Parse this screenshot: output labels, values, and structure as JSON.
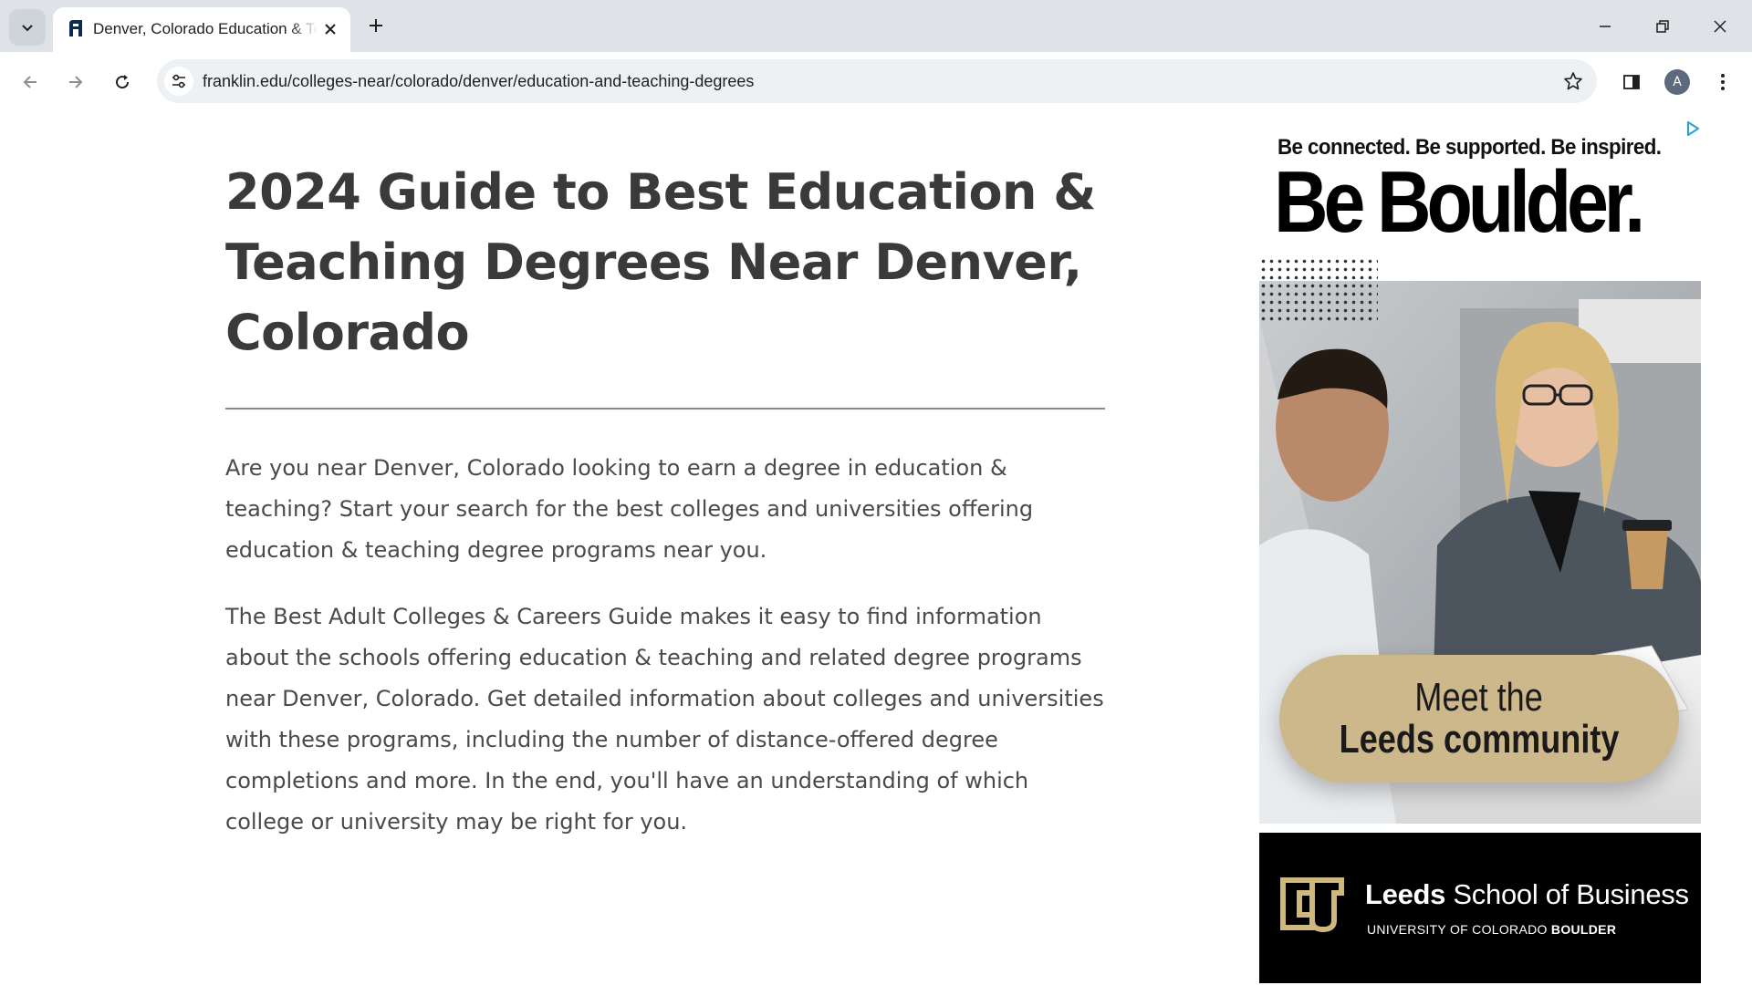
{
  "browser": {
    "tab": {
      "title": "Denver, Colorado Education & Teaching Degrees",
      "favicon": "franklin-logo-icon"
    },
    "url": "franklin.edu/colleges-near/colorado/denver/education-and-teaching-degrees",
    "profile_initial": "A",
    "colors": {
      "tabstrip": "#dfe3e7",
      "omnibox": "#eef1f4",
      "avatar": "#5d6a7d"
    }
  },
  "article": {
    "heading": "2024 Guide to Best Education & Teaching Degrees Near Denver, Colorado",
    "paragraph_1": "Are you near Denver, Colorado looking to earn a degree in education & teaching? Start your search for the best colleges and universities offering education & teaching degree programs near you.",
    "paragraph_2": "The Best Adult Colleges & Careers Guide makes it easy to find information about the schools offering education & teaching and related degree programs near Denver, Colorado. Get detailed information about colleges and universities with these programs, including the number of distance-offered degree completions and more. In the end, you'll have an understanding of which college or university may be right for you."
  },
  "ad": {
    "tagline": "Be connected. Be supported. Be inspired.",
    "headline": "Be Boulder.",
    "cta_line1": "Meet the",
    "cta_line2": "Leeds community",
    "school_bold": "Leeds",
    "school_rest": " School of Business",
    "university_prefix": "UNIVERSITY OF COLORADO ",
    "university_bold": "BOULDER",
    "colors": {
      "pill": "#cdb88b",
      "footer": "#000000",
      "logo_gold": "#cfb87c"
    }
  }
}
